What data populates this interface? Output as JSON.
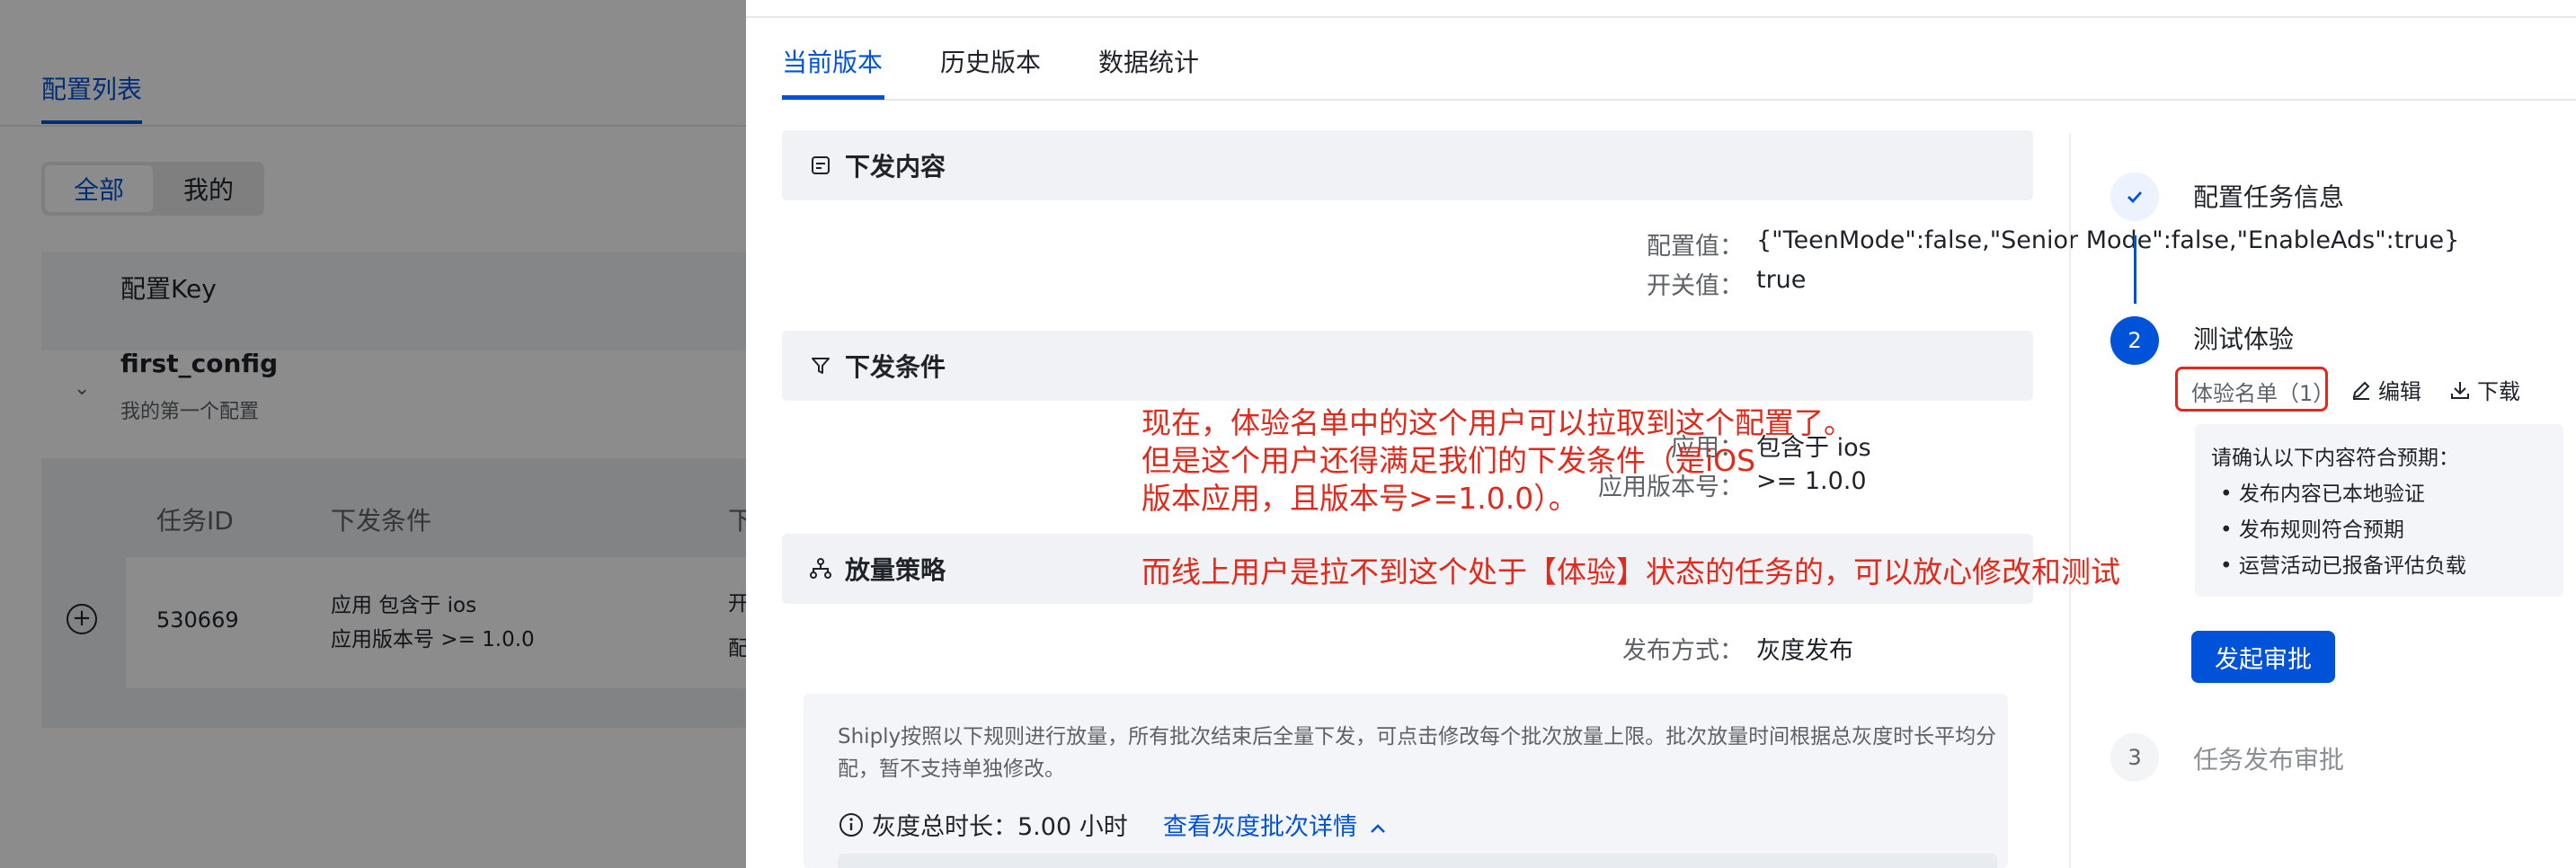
{
  "background": {
    "tab": "配置列表",
    "segment": {
      "all": "全部",
      "mine": "我的"
    },
    "table_header": "配置Key",
    "row": {
      "key": "first_config",
      "desc": "我的第一个配置"
    },
    "subtable": {
      "headers": [
        "任务ID",
        "下发条件",
        "下"
      ],
      "row": {
        "id": "530669",
        "cond_line1": "应用 包含于 ios",
        "cond_line2": "应用版本号 >= 1.0.0",
        "col3_line1": "开",
        "col3_line2": "配"
      }
    }
  },
  "drawer": {
    "tabs": [
      {
        "label": "当前版本",
        "active": true
      },
      {
        "label": "历史版本",
        "active": false
      },
      {
        "label": "数据统计",
        "active": false
      }
    ],
    "content_section": {
      "title": "下发内容",
      "config_value_label": "配置值：",
      "config_value": "{\"TeenMode\":false,\"Senior Mode\":false,\"EnableAds\":true}",
      "switch_label": "开关值：",
      "switch_value": "true"
    },
    "condition_section": {
      "title": "下发条件",
      "app_label": "应用：",
      "app_value": "包含于 ios",
      "version_label": "应用版本号：",
      "version_value": ">= 1.0.0"
    },
    "strategy_section": {
      "title": "放量策略",
      "method_label": "发布方式：",
      "method_value": "灰度发布",
      "note": "Shiply按照以下规则进行放量，所有批次结束后全量下发，可点击修改每个批次放量上限。批次放量时间根据总灰度时长平均分配，暂不支持单独修改。",
      "duration_label": "灰度总时长：",
      "duration_value": "5.00 小时",
      "detail_link": "查看灰度批次详情"
    },
    "steps": {
      "step1": {
        "title": "配置任务信息"
      },
      "step2": {
        "number": "2",
        "title": "测试体验",
        "tag": "体验名单（1）",
        "edit": "编辑",
        "download": "下载",
        "checklist_title": "请确认以下内容符合预期：",
        "checklist": [
          "发布内容已本地验证",
          "发布规则符合预期",
          "运营活动已报备评估负载"
        ],
        "approve_button": "发起审批"
      },
      "step3": {
        "number": "3",
        "title": "任务发布审批"
      }
    }
  },
  "annotations": {
    "line1": "现在，体验名单中的这个用户可以拉取到这个配置了。",
    "line2": "但是这个用户还得满足我们的下发条件（是iOS",
    "line3": "版本应用，且版本号>=1.0.0）。",
    "line4": "而线上用户是拉不到这个处于【体验】状态的任务的，可以放心修改和测试"
  },
  "colors": {
    "primary": "#0052d9",
    "annotation_red": "#e02a1c",
    "section_bg": "#f0f2f5"
  }
}
